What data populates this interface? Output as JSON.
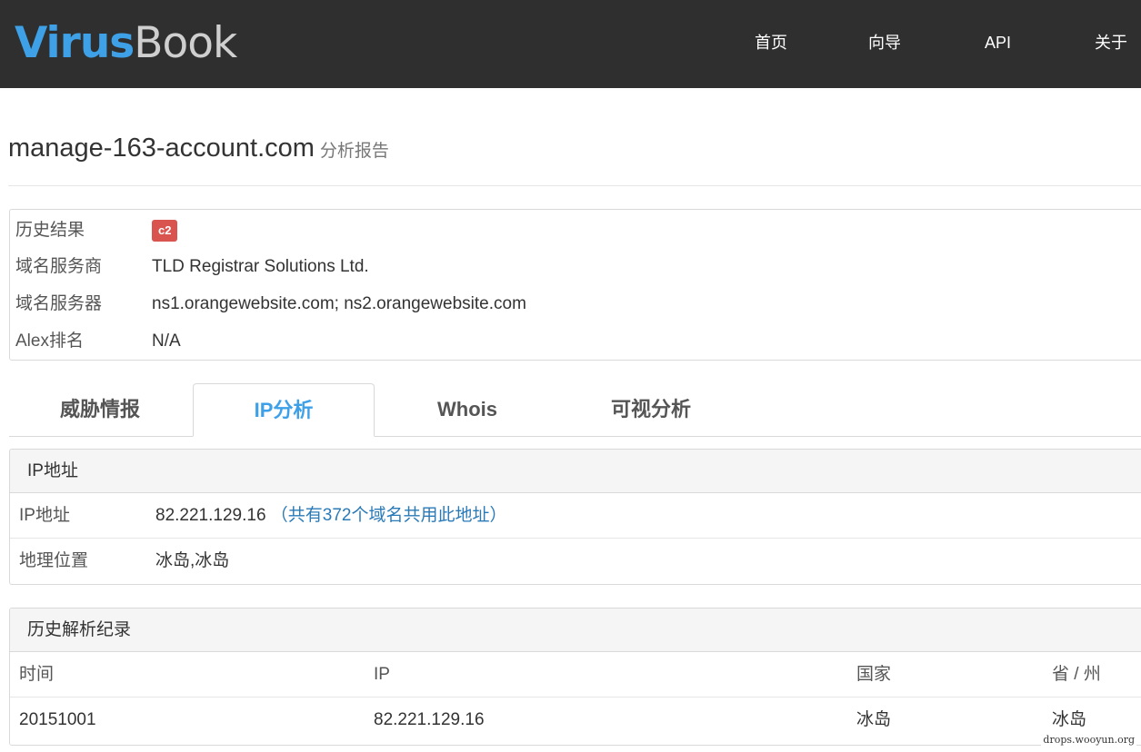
{
  "navbar": {
    "logo_a": "Virus",
    "logo_b": "Book",
    "items": [
      "首页",
      "向导",
      "API",
      "关于"
    ]
  },
  "title": {
    "domain": "manage-163-account.com",
    "subtitle": "分析报告"
  },
  "summary": {
    "history_label": "历史结果",
    "history_badge": "c2",
    "registrar_label": "域名服务商",
    "registrar_value": "TLD Registrar Solutions Ltd.",
    "nameserver_label": "域名服务器",
    "nameserver_value": "ns1.orangewebsite.com; ns2.orangewebsite.com",
    "alexa_label": "Alex排名",
    "alexa_value": "N/A"
  },
  "tabs": [
    {
      "label": "威胁情报",
      "active": false
    },
    {
      "label": "IP分析",
      "active": true
    },
    {
      "label": "Whois",
      "active": false
    },
    {
      "label": "可视分析",
      "active": false
    }
  ],
  "ip_panel": {
    "heading": "IP地址",
    "ip_label": "IP地址",
    "ip_value": "82.221.129.16",
    "shared_link": "（共有372个域名共用此地址）",
    "geo_label": "地理位置",
    "geo_value": "冰岛,冰岛"
  },
  "history_panel": {
    "heading": "历史解析纪录",
    "columns": [
      "时间",
      "IP",
      "国家",
      "省 / 州"
    ],
    "rows": [
      [
        "20151001",
        "82.221.129.16",
        "冰岛",
        "冰岛"
      ]
    ]
  },
  "watermark": "drops.wooyun.org",
  "colors": {
    "navbar_bg": "#2f2f2f",
    "brand_blue": "#3ea1e8",
    "badge_red": "#d9534f",
    "link_blue": "#2a7ab8"
  }
}
